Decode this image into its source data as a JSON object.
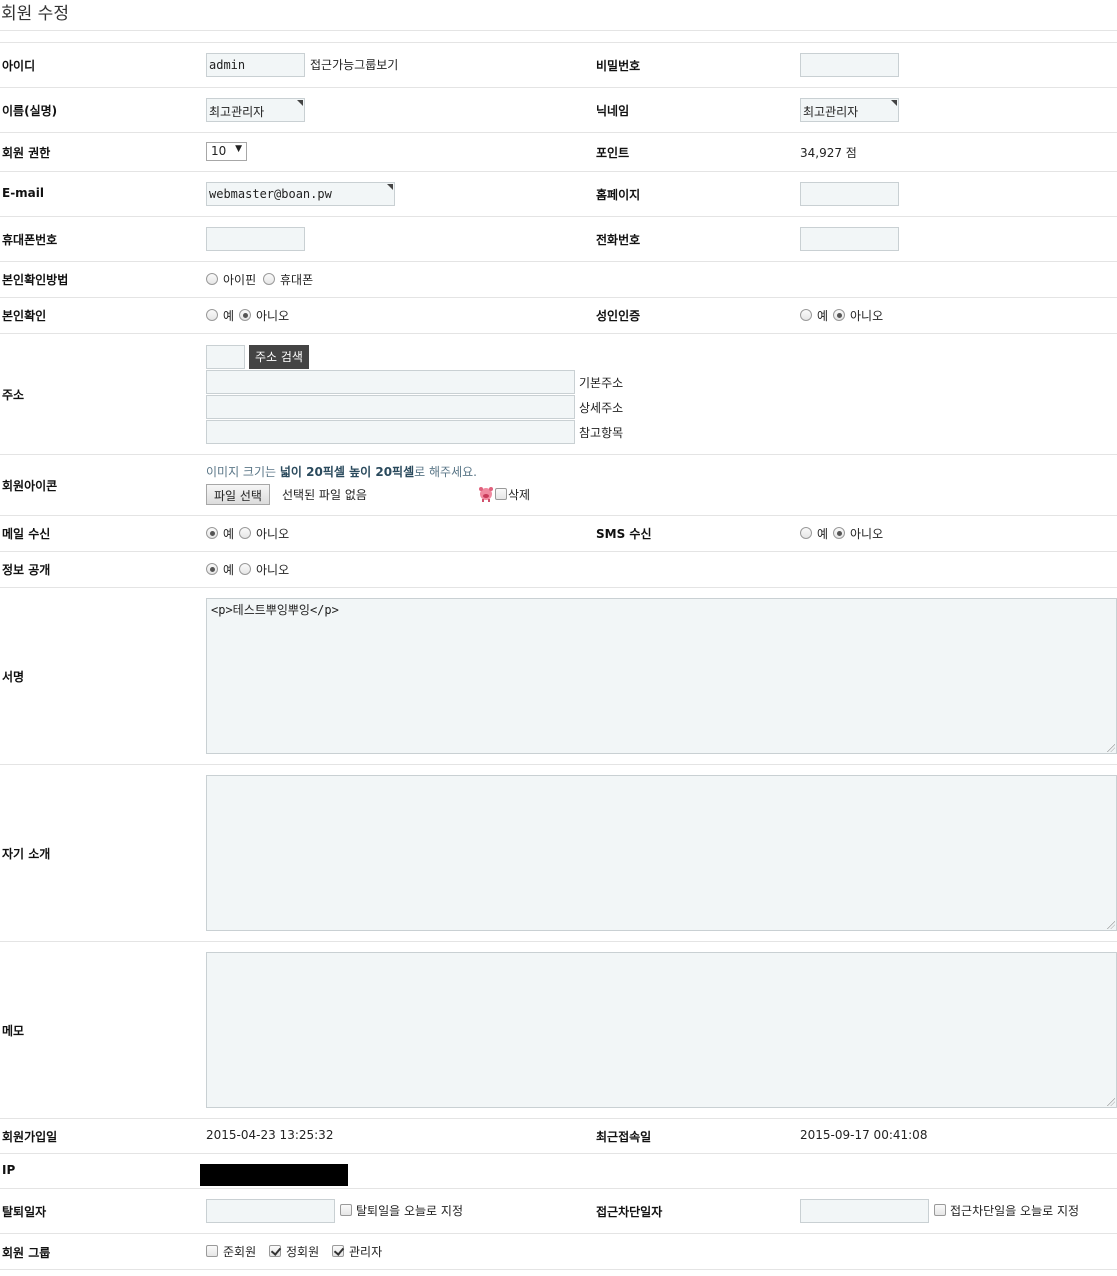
{
  "page": {
    "title": "회원 수정"
  },
  "fields": {
    "id": {
      "label": "아이디",
      "value": "admin",
      "link": "접근가능그룹보기"
    },
    "password": {
      "label": "비밀번호",
      "value": ""
    },
    "name": {
      "label": "이름(실명)",
      "value": "최고관리자"
    },
    "nickname": {
      "label": "닉네임",
      "value": "최고관리자"
    },
    "level": {
      "label": "회원 권한",
      "value": "10"
    },
    "point": {
      "label": "포인트",
      "value": "34,927 점"
    },
    "email": {
      "label": "E-mail",
      "value": "webmaster@boan.pw"
    },
    "homepage": {
      "label": "홈페이지",
      "value": ""
    },
    "mobile": {
      "label": "휴대폰번호",
      "value": ""
    },
    "phone": {
      "label": "전화번호",
      "value": ""
    },
    "cert_method": {
      "label": "본인확인방법",
      "options": [
        "아이핀",
        "휴대폰"
      ]
    },
    "cert": {
      "label": "본인확인",
      "options": [
        "예",
        "아니오"
      ],
      "selected": "아니오"
    },
    "adult": {
      "label": "성인인증",
      "options": [
        "예",
        "아니오"
      ],
      "selected": "아니오"
    },
    "address": {
      "label": "주소",
      "search_button": "주소 검색",
      "addr1_label": "기본주소",
      "addr2_label": "상세주소",
      "addr3_label": "참고항목"
    },
    "icon": {
      "label": "회원아이콘",
      "hint_pre": "이미지 크기는 ",
      "hint_bold": "넓이 20픽셀 높이 20픽셀",
      "hint_post": "로 해주세요.",
      "file_button": "파일 선택",
      "file_status": "선택된 파일 없음",
      "delete_label": "삭제"
    },
    "mailling": {
      "label": "메일 수신",
      "options": [
        "예",
        "아니오"
      ],
      "selected": "예"
    },
    "sms": {
      "label": "SMS 수신",
      "options": [
        "예",
        "아니오"
      ],
      "selected": "아니오"
    },
    "open": {
      "label": "정보 공개",
      "options": [
        "예",
        "아니오"
      ],
      "selected": "예"
    },
    "signature": {
      "label": "서명",
      "value": "<p>테스트뿌잉뿌잉</p>"
    },
    "profile": {
      "label": "자기 소개",
      "value": ""
    },
    "memo": {
      "label": "메모",
      "value": ""
    },
    "join_date": {
      "label": "회원가입일",
      "value": "2015-04-23 13:25:32"
    },
    "last_login": {
      "label": "최근접속일",
      "value": "2015-09-17 00:41:08"
    },
    "ip": {
      "label": "IP"
    },
    "leave_date": {
      "label": "탈퇴일자",
      "checkbox_label": "탈퇴일을 오늘로 지정"
    },
    "intercept_date": {
      "label": "접근차단일자",
      "checkbox_label": "접근차단일을 오늘로 지정"
    },
    "group": {
      "label": "회원 그룹",
      "items": [
        {
          "label": "준회원",
          "checked": false
        },
        {
          "label": "정회원",
          "checked": true
        },
        {
          "label": "관리자",
          "checked": true
        }
      ]
    }
  }
}
